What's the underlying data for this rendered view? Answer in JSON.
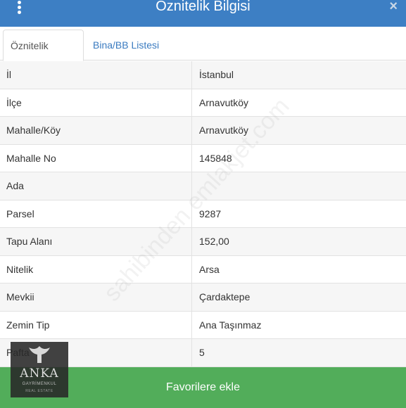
{
  "header": {
    "title": "Öznitelik Bilgisi",
    "close_symbol": "×"
  },
  "tabs": [
    {
      "label": "Öznitelik Bilgisi",
      "active": true
    },
    {
      "label": "Bina/BB Listesi",
      "active": false
    }
  ],
  "attributes": [
    {
      "key": "İl",
      "value": "İstanbul"
    },
    {
      "key": "İlçe",
      "value": "Arnavutköy"
    },
    {
      "key": "Mahalle/Köy",
      "value": "Arnavutköy"
    },
    {
      "key": "Mahalle No",
      "value": "145848"
    },
    {
      "key": "Ada",
      "value": ""
    },
    {
      "key": "Parsel",
      "value": "9287"
    },
    {
      "key": "Tapu Alanı",
      "value": "152,00"
    },
    {
      "key": "Nitelik",
      "value": "Arsa"
    },
    {
      "key": "Mevkii",
      "value": "Çardaktepe"
    },
    {
      "key": "Zemin Tip",
      "value": "Ana Taşınmaz"
    },
    {
      "key": "Pafta",
      "value": "5"
    }
  ],
  "footer": {
    "favorite_label": "Favorilere ekle"
  },
  "logo": {
    "name": "ANKA",
    "subtitle": "GAYRİMENKUL",
    "tagline": "REAL ESTATE"
  },
  "watermark": {
    "text": "sahibinden emlakjet.com"
  },
  "colors": {
    "header": "#3d7fc4",
    "tab_link": "#3a7bc0",
    "favorite_button": "#52ad5a"
  },
  "icons": {
    "menu": "vertical-dots-icon",
    "close": "close-icon"
  }
}
